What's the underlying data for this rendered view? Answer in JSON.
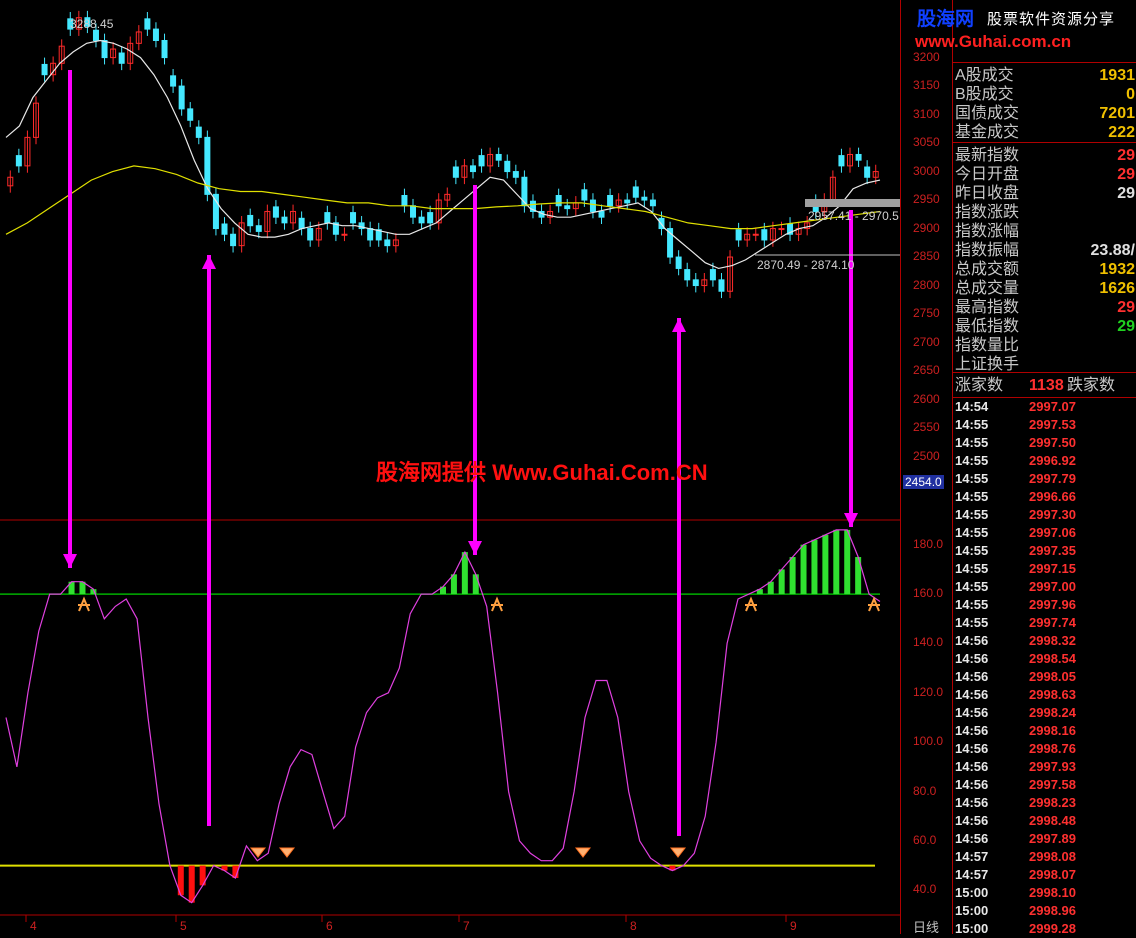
{
  "chart_data": [
    {
      "type": "candlestick",
      "title": "",
      "ylim": [
        2450,
        3280
      ],
      "y_ticks": [
        2500,
        2550,
        2600,
        2650,
        2700,
        2750,
        2800,
        2850,
        2900,
        2950,
        3000,
        3050,
        3100,
        3150,
        3200
      ],
      "annotations": [
        "3288.45",
        "2957.41 - 2970.5",
        "2870.49 - 2874.10"
      ],
      "price_tag": "2454.0",
      "x_ticks": [
        "4",
        "5",
        "6",
        "7",
        "8",
        "9"
      ],
      "close": [
        2990,
        3010,
        3060,
        3120,
        3170,
        3190,
        3220,
        3250,
        3270,
        3255,
        3230,
        3200,
        3215,
        3190,
        3225,
        3245,
        3250,
        3230,
        3200,
        3150,
        3110,
        3090,
        3060,
        2960,
        2900,
        2890,
        2870,
        2910,
        2905,
        2895,
        2930,
        2920,
        2910,
        2930,
        2900,
        2880,
        2900,
        2910,
        2890,
        2890,
        2910,
        2900,
        2880,
        2880,
        2870,
        2880,
        2940,
        2920,
        2910,
        2910,
        2950,
        2960,
        2990,
        3010,
        3000,
        3010,
        3030,
        3020,
        3000,
        2990,
        2940,
        2930,
        2920,
        2930,
        2940,
        2935,
        2945,
        2950,
        2930,
        2920,
        2940,
        2950,
        2945,
        2955,
        2950,
        2940,
        2900,
        2850,
        2830,
        2810,
        2800,
        2810,
        2810,
        2790,
        2850,
        2880,
        2890,
        2890,
        2880,
        2900,
        2900,
        2890,
        2900,
        2910,
        2930,
        2950,
        2990,
        3010,
        3030,
        3020,
        2990,
        3000
      ],
      "ma_fast": [
        3060,
        3080,
        3130,
        3160,
        3190,
        3210,
        3225,
        3230,
        3225,
        3215,
        3200,
        3170,
        3130,
        3080,
        3020,
        2970,
        2935,
        2910,
        2890,
        2885,
        2885,
        2890,
        2900,
        2905,
        2910,
        2905,
        2905,
        2900,
        2895,
        2890,
        2890,
        2900,
        2910,
        2930,
        2950,
        2970,
        2990,
        2985,
        2960,
        2935,
        2925,
        2920,
        2920,
        2925,
        2930,
        2935,
        2940,
        2945,
        2930,
        2900,
        2880,
        2860,
        2840,
        2830,
        2835,
        2845,
        2860,
        2875,
        2890,
        2900,
        2905,
        2920,
        2940,
        2970,
        2980,
        2985
      ],
      "ma_slow": [
        2890,
        2910,
        2935,
        2960,
        2985,
        3000,
        3010,
        3005,
        2995,
        2980,
        2970,
        2965,
        2965,
        2960,
        2955,
        2950,
        2945,
        2945,
        2940,
        2940,
        2935,
        2935,
        2935,
        2938,
        2940,
        2943,
        2945,
        2945,
        2940,
        2935,
        2930,
        2920,
        2910,
        2905,
        2900,
        2900,
        2905,
        2910,
        2915,
        2920,
        2925,
        2930
      ]
    },
    {
      "type": "line",
      "title": "",
      "ylim": [
        30,
        190
      ],
      "y_ticks": [
        40.0,
        60.0,
        80.0,
        100.0,
        120.0,
        140.0,
        160.0,
        180.0
      ],
      "levels": [
        160,
        50
      ],
      "series": [
        {
          "values": [
            110,
            90,
            120,
            145,
            160,
            160,
            165,
            165,
            162,
            150,
            155,
            158,
            150,
            110,
            75,
            50,
            38,
            35,
            42,
            50,
            48,
            45,
            58,
            52,
            55,
            75,
            90,
            97,
            95,
            80,
            65,
            70,
            98,
            112,
            118,
            120,
            130,
            152,
            160,
            160,
            163,
            168,
            177,
            168,
            155,
            120,
            80,
            60,
            55,
            52,
            52,
            57,
            80,
            110,
            125,
            125,
            110,
            80,
            60,
            53,
            50,
            48,
            50,
            55,
            70,
            100,
            140,
            158,
            160,
            162,
            165,
            170,
            175,
            180,
            182,
            184,
            186,
            186,
            175,
            160,
            157
          ]
        }
      ]
    }
  ],
  "watermark": "股海网提供 Www.Guhai.Com.CN",
  "period_label": "日线",
  "logo": {
    "brand": "股海网",
    "tag": "股票软件资源分享",
    "url": "www.Guhai.com.cn"
  },
  "panel": {
    "rows": [
      {
        "k": "A股成交",
        "v": "1931",
        "c": "#f0c000"
      },
      {
        "k": "B股成交",
        "v": "0",
        "c": "#f0c000"
      },
      {
        "k": "国债成交",
        "v": "7201",
        "c": "#f0c000"
      },
      {
        "k": "基金成交",
        "v": "222",
        "c": "#f0c000"
      },
      {
        "k": "最新指数",
        "v": "29",
        "c": "#ff3030"
      },
      {
        "k": "今日开盘",
        "v": "29",
        "c": "#ff3030"
      },
      {
        "k": "昨日收盘",
        "v": "29",
        "c": "#e0e0e0"
      },
      {
        "k": "指数涨跌",
        "v": "",
        "c": "#ff3030"
      },
      {
        "k": "指数涨幅",
        "v": "",
        "c": "#ff3030"
      },
      {
        "k": "指数振幅",
        "v": "23.88/",
        "c": "#e0e0e0"
      },
      {
        "k": "总成交额",
        "v": "1932",
        "c": "#f0c000"
      },
      {
        "k": "总成交量",
        "v": "1626",
        "c": "#f0c000"
      },
      {
        "k": "最高指数",
        "v": "29",
        "c": "#ff3030"
      },
      {
        "k": "最低指数",
        "v": "29",
        "c": "#20d020"
      },
      {
        "k": "指数量比",
        "v": "",
        "c": "#e0e0e0"
      },
      {
        "k": "上证换手",
        "v": "",
        "c": "#e0e0e0"
      }
    ],
    "updown": {
      "up_label": "涨家数",
      "up": "1138",
      "down_label": "跌家数"
    },
    "ticks": [
      [
        "14:54",
        "2997.07"
      ],
      [
        "14:55",
        "2997.53"
      ],
      [
        "14:55",
        "2997.50"
      ],
      [
        "14:55",
        "2996.92"
      ],
      [
        "14:55",
        "2997.79"
      ],
      [
        "14:55",
        "2996.66"
      ],
      [
        "14:55",
        "2997.30"
      ],
      [
        "14:55",
        "2997.06"
      ],
      [
        "14:55",
        "2997.35"
      ],
      [
        "14:55",
        "2997.15"
      ],
      [
        "14:55",
        "2997.00"
      ],
      [
        "14:55",
        "2997.96"
      ],
      [
        "14:55",
        "2997.74"
      ],
      [
        "14:56",
        "2998.32"
      ],
      [
        "14:56",
        "2998.54"
      ],
      [
        "14:56",
        "2998.05"
      ],
      [
        "14:56",
        "2998.63"
      ],
      [
        "14:56",
        "2998.24"
      ],
      [
        "14:56",
        "2998.16"
      ],
      [
        "14:56",
        "2998.76"
      ],
      [
        "14:56",
        "2997.93"
      ],
      [
        "14:56",
        "2997.58"
      ],
      [
        "14:56",
        "2998.23"
      ],
      [
        "14:56",
        "2998.48"
      ],
      [
        "14:56",
        "2997.89"
      ],
      [
        "14:57",
        "2998.08"
      ],
      [
        "14:57",
        "2998.07"
      ],
      [
        "15:00",
        "2998.10"
      ],
      [
        "15:00",
        "2998.96"
      ],
      [
        "15:00",
        "2999.28"
      ]
    ]
  },
  "colors": {
    "up": "#ff2a2a",
    "down": "#44e8ff",
    "fast_ma": "#e8e8e8",
    "slow_ma": "#e0e000",
    "indicator": "#e040e0",
    "arrow": "#ff00ff",
    "green_bar": "#30e030",
    "red_bar": "#ff1010",
    "upper_level": "#00b000",
    "lower_level": "#e0e000"
  }
}
